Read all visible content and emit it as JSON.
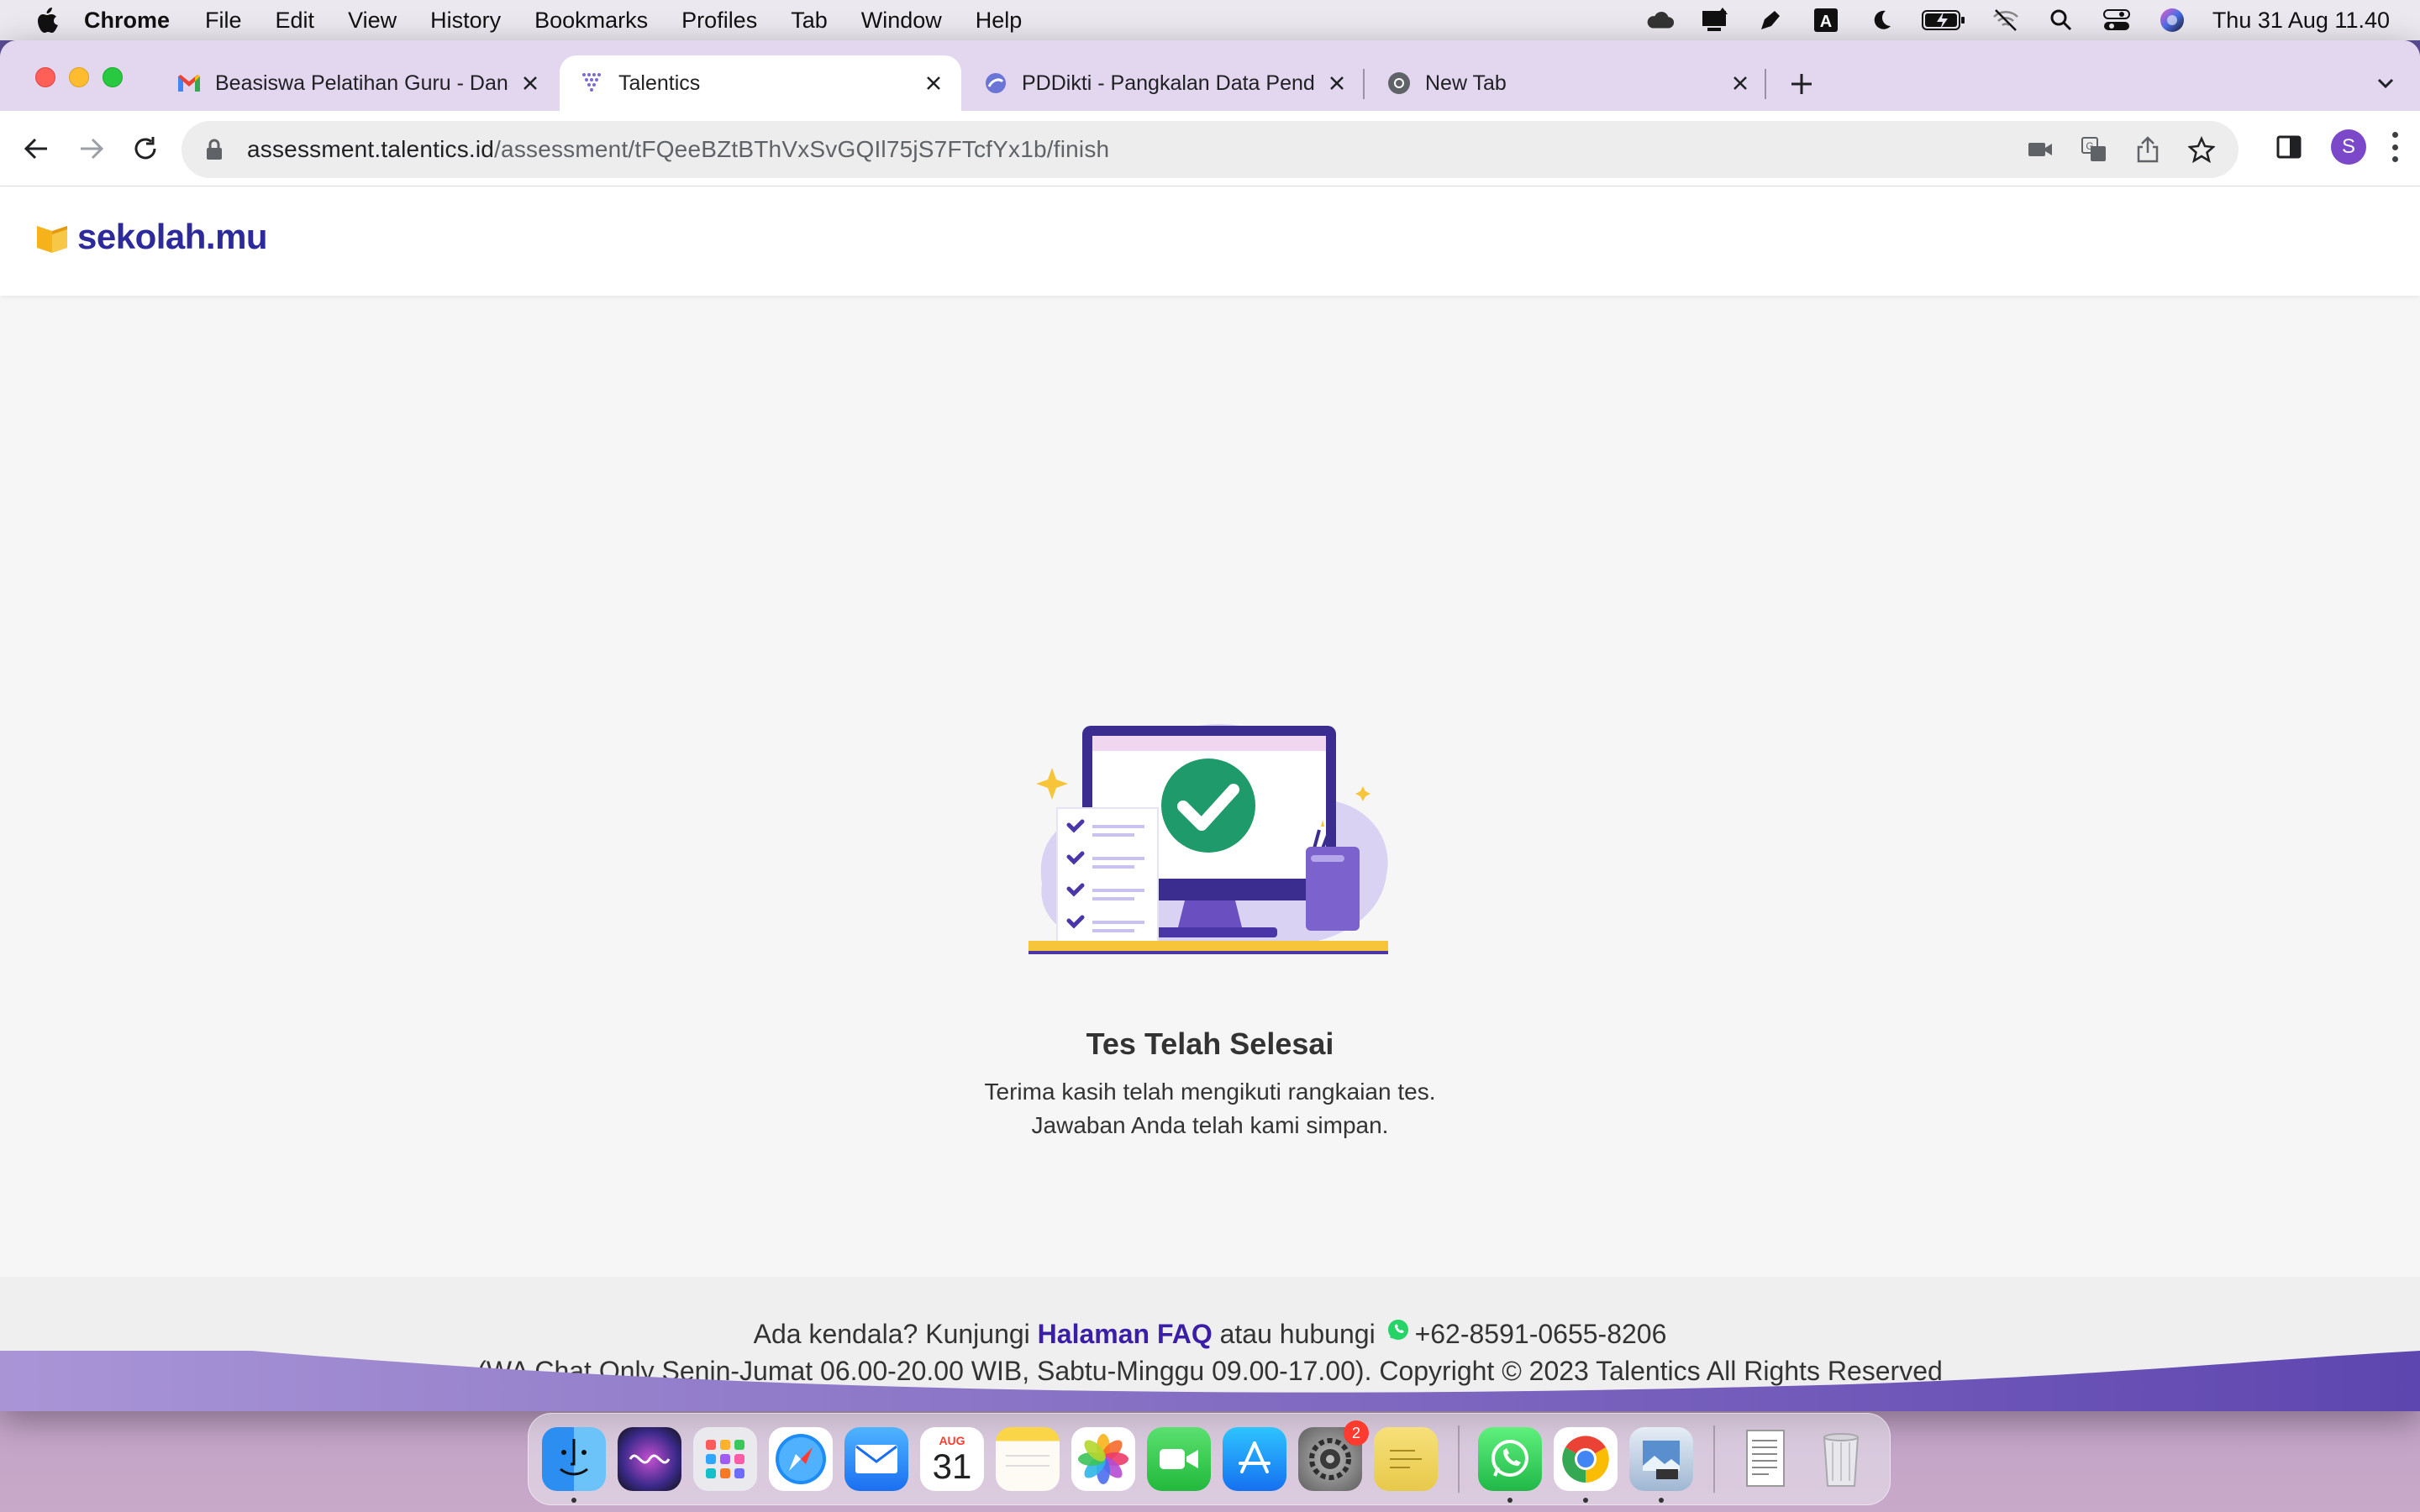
{
  "menubar": {
    "app_name": "Chrome",
    "menus": [
      "File",
      "Edit",
      "View",
      "History",
      "Bookmarks",
      "Profiles",
      "Tab",
      "Window",
      "Help"
    ],
    "clock": "Thu 31 Aug  11.40",
    "status_icons": [
      "creative-cloud-icon",
      "notification-icon",
      "pen-icon",
      "input-source-icon",
      "focus-moon-icon",
      "battery-charging-icon",
      "wifi-off-icon",
      "spotlight-search-icon",
      "control-center-icon",
      "siri-icon"
    ]
  },
  "browser": {
    "tabs": [
      {
        "title": "Beasiswa Pelatihan Guru - Dana",
        "favicon": "gmail-icon",
        "active": false
      },
      {
        "title": "Talentics",
        "favicon": "talentics-icon",
        "active": true
      },
      {
        "title": "PDDikti - Pangkalan Data Pendi",
        "favicon": "pddikti-icon",
        "active": false
      },
      {
        "title": "New Tab",
        "favicon": "chrome-icon",
        "active": false
      }
    ],
    "url_host": "assessment.talentics.id",
    "url_path": "/assessment/tFQeeBZtBThVxSvGQIl75jS7FTcfYx1b/finish",
    "profile_initial": "S"
  },
  "page": {
    "logo_text": "sekolah.mu",
    "title": "Tes Telah Selesai",
    "message_line1": "Terima kasih telah mengikuti rangkaian tes.",
    "message_line2": "Jawaban Anda telah kami simpan.",
    "footer": {
      "prefix": "Ada kendala? Kunjungi ",
      "faq_link": "Halaman FAQ",
      "middle": " atau hubungi ",
      "phone": "+62-8591-0655-8206",
      "line2": "(WA Chat Only Senin-Jumat 06.00-20.00 WIB, Sabtu-Minggu 09.00-17.00). Copyright © 2023 Talentics All Rights Reserved"
    },
    "colors": {
      "brand": "#2d2a9b",
      "accent_purple": "#6a4fc0",
      "success_green": "#1f9a6a",
      "yellow": "#f7c53a"
    }
  },
  "dock": {
    "apps": [
      "finder-icon",
      "siri-icon",
      "launchpad-icon",
      "safari-icon",
      "mail-icon",
      "calendar-icon",
      "notes-icon",
      "photos-icon",
      "facetime-icon",
      "app-store-icon",
      "system-settings-icon",
      "stickies-icon",
      "whatsapp-icon",
      "chrome-icon",
      "preview-icon",
      "document-icon",
      "trash-icon"
    ],
    "calendar_month": "AUG",
    "calendar_day": "31",
    "settings_badge": "2"
  }
}
